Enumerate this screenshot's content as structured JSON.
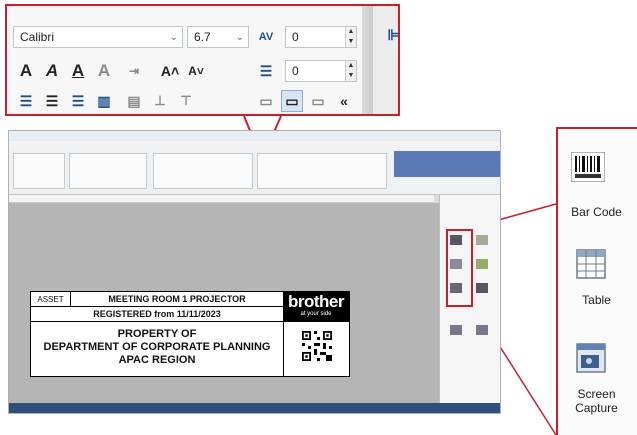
{
  "toolbar": {
    "font_name": "Calibri",
    "font_size": "6.7",
    "char_spacing_value": "0",
    "line_spacing_value": "0",
    "collapse_glyph": "«"
  },
  "label": {
    "asset": "ASSET",
    "room": "MEETING ROOM 1 PROJECTOR",
    "registered": "REGISTERED from 11/11/2023",
    "property_line1": "PROPERTY OF",
    "property_line2": "DEPARTMENT OF CORPORATE PLANNING",
    "property_line3": "APAC REGION",
    "brand": "brother",
    "tagline": "at your side"
  },
  "side_panel": {
    "items": [
      {
        "label": "Bar Code",
        "icon": "barcode-icon"
      },
      {
        "label": "Table",
        "icon": "table-icon"
      },
      {
        "label": "Screen Capture",
        "label_line1": "Screen",
        "label_line2": "Capture",
        "icon": "screen-capture-icon"
      }
    ]
  },
  "colors": {
    "highlight": "#c8202a",
    "ribbon_blue": "#5b7ab5",
    "status_bar": "#2f4f7a",
    "canvas": "#b5b5b5"
  }
}
